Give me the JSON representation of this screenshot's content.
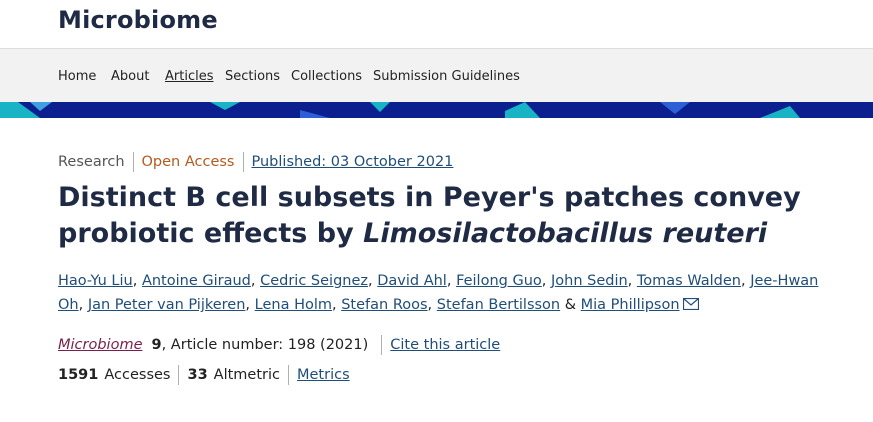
{
  "journal": {
    "title": "Microbiome"
  },
  "nav": {
    "items": [
      {
        "label": "Home"
      },
      {
        "label": "About"
      },
      {
        "label": "Articles"
      },
      {
        "label": "Sections"
      },
      {
        "label": "Collections"
      },
      {
        "label": "Submission Guidelines"
      }
    ],
    "active": "Articles"
  },
  "colors": {
    "band_navy": "#0b1f8f",
    "band_teal": "#19b3c6",
    "title": "#1f2a44",
    "link": "#1f4e79",
    "open_access": "#b35a1f",
    "journal_link": "#7a1f4b"
  },
  "article": {
    "type": "Research",
    "access": "Open Access",
    "published": "Published: 03 October 2021",
    "title_main": "Distinct B cell subsets in Peyer's patches convey probiotic effects by ",
    "title_species": "Limosilactobacillus reuteri",
    "authors": [
      "Hao-Yu Liu",
      "Antoine Giraud",
      "Cedric Seignez",
      "David Ahl",
      "Feilong Guo",
      "John Sedin",
      "Tomas Walden",
      "Jee-Hwan Oh",
      "Jan Peter van Pijkeren",
      "Lena Holm",
      "Stefan Roos",
      "Stefan Bertilsson",
      "Mia Phillipson"
    ],
    "author_separator": ", ",
    "last_author_joiner": " & ",
    "contact_icon": "envelope-icon",
    "journal_name": "Microbiome",
    "volume": "9",
    "article_number": ", Article number: 198 (2021)",
    "cite_label": "Cite this article",
    "accesses_count": "1591",
    "accesses_label": "Accesses",
    "altmetric_count": "33",
    "altmetric_label": "Altmetric",
    "metrics_label": "Metrics"
  }
}
